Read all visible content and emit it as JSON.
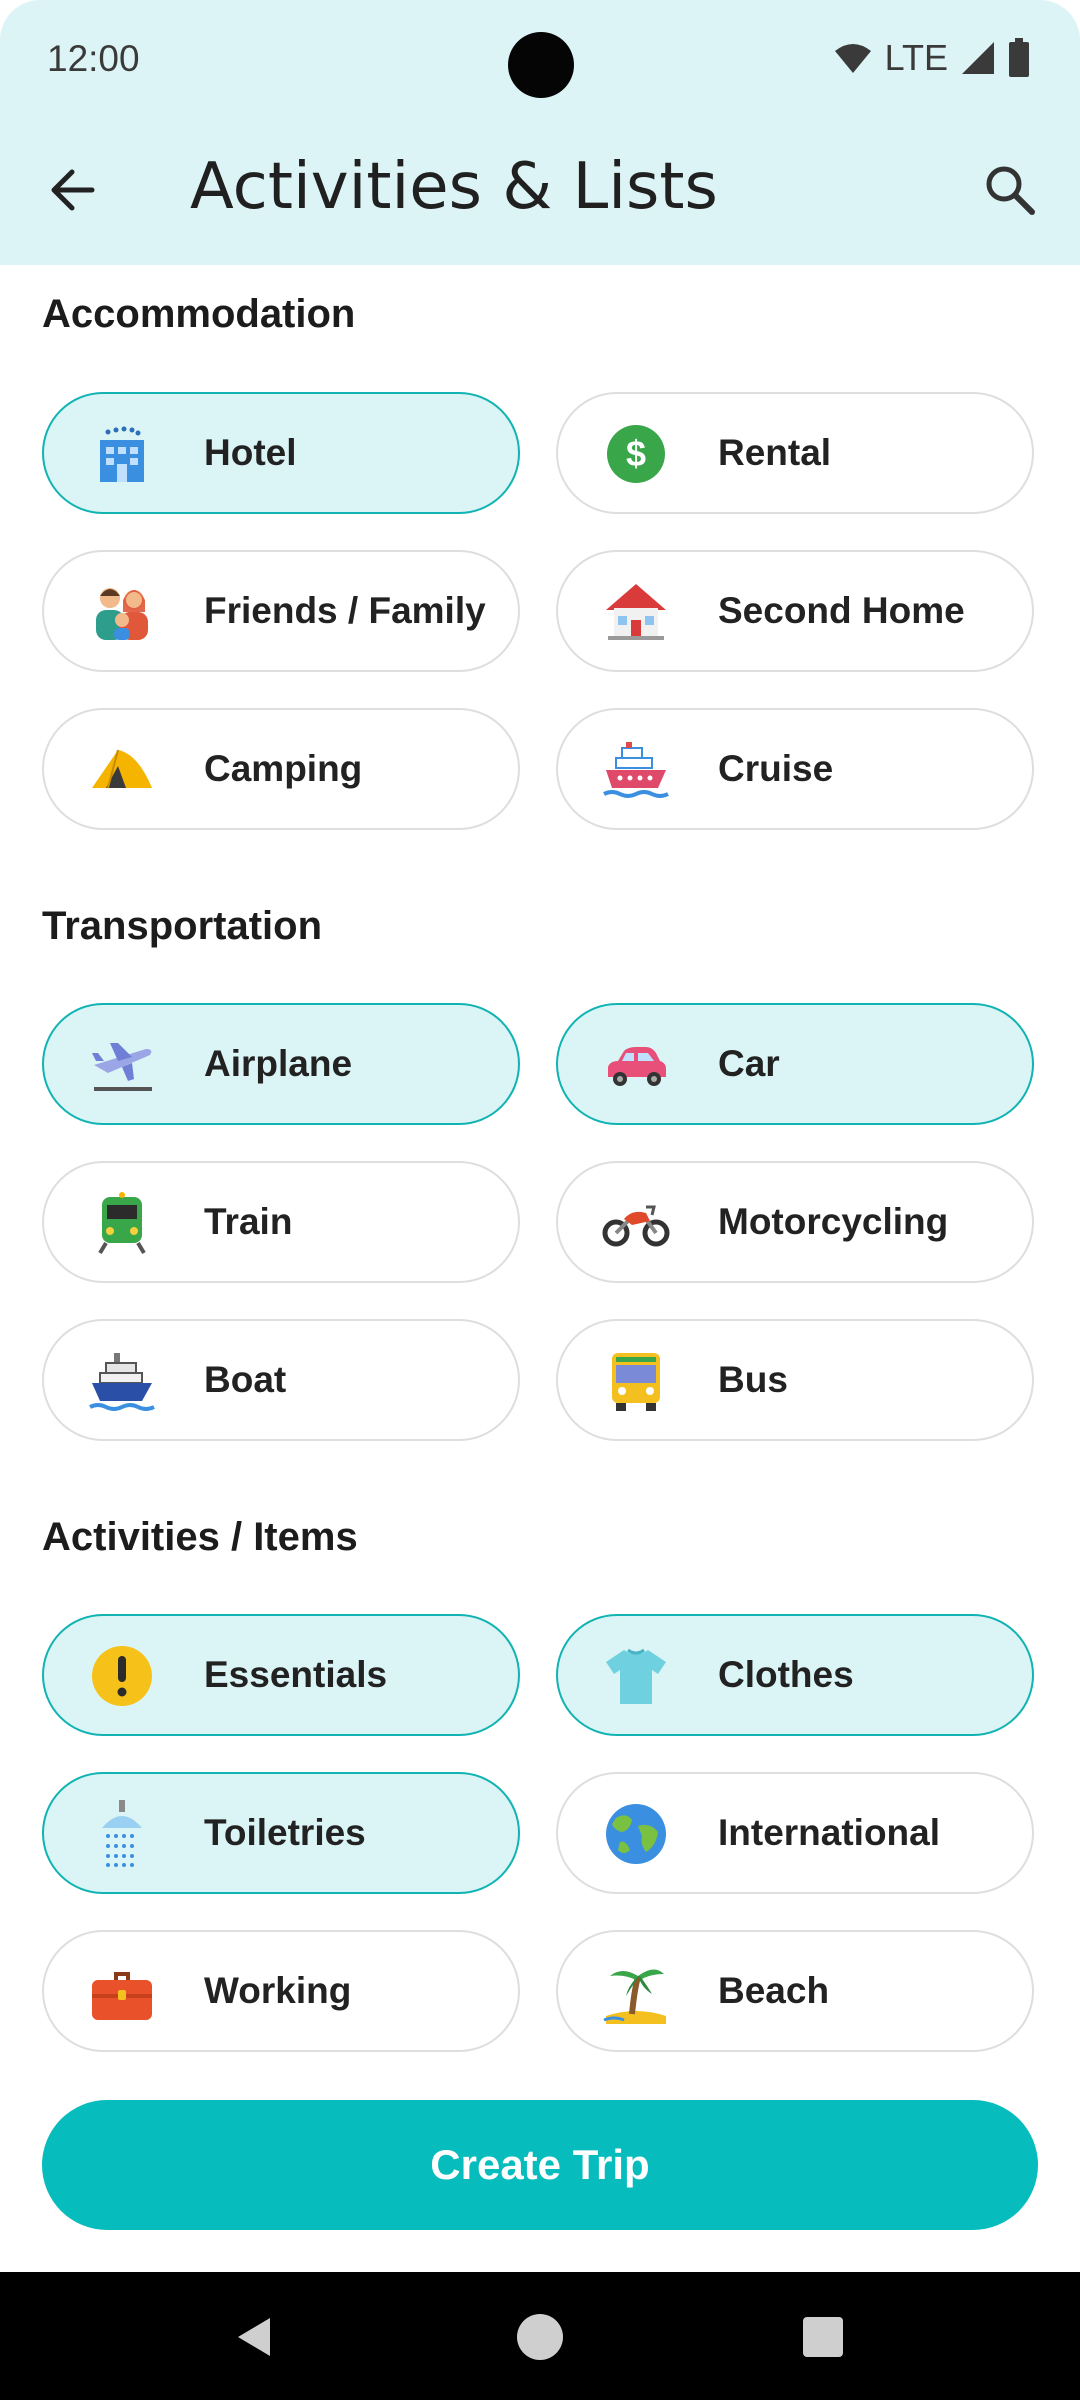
{
  "status": {
    "time": "12:00",
    "network": "LTE"
  },
  "header": {
    "title": "Activities & Lists"
  },
  "sections": [
    {
      "title": "Accommodation",
      "items": [
        {
          "label": "Hotel",
          "icon": "hotel-icon",
          "selected": true
        },
        {
          "label": "Rental",
          "icon": "dollar-icon",
          "selected": false
        },
        {
          "label": "Friends / Family",
          "icon": "family-icon",
          "selected": false
        },
        {
          "label": "Second Home",
          "icon": "house-icon",
          "selected": false
        },
        {
          "label": "Camping",
          "icon": "tent-icon",
          "selected": false
        },
        {
          "label": "Cruise",
          "icon": "cruise-ship-icon",
          "selected": false
        }
      ]
    },
    {
      "title": "Transportation",
      "items": [
        {
          "label": "Airplane",
          "icon": "airplane-icon",
          "selected": true
        },
        {
          "label": "Car",
          "icon": "car-icon",
          "selected": true
        },
        {
          "label": "Train",
          "icon": "train-icon",
          "selected": false
        },
        {
          "label": "Motorcycling",
          "icon": "motorcycle-icon",
          "selected": false
        },
        {
          "label": "Boat",
          "icon": "boat-icon",
          "selected": false
        },
        {
          "label": "Bus",
          "icon": "bus-icon",
          "selected": false
        }
      ]
    },
    {
      "title": "Activities / Items",
      "items": [
        {
          "label": "Essentials",
          "icon": "exclamation-icon",
          "selected": true
        },
        {
          "label": "Clothes",
          "icon": "tshirt-icon",
          "selected": true
        },
        {
          "label": "Toiletries",
          "icon": "shower-icon",
          "selected": true
        },
        {
          "label": "International",
          "icon": "globe-icon",
          "selected": false
        },
        {
          "label": "Working",
          "icon": "briefcase-icon",
          "selected": false
        },
        {
          "label": "Beach",
          "icon": "palm-tree-icon",
          "selected": false
        }
      ]
    }
  ],
  "actions": {
    "create_label": "Create Trip"
  },
  "colors": {
    "accent": "#06bcbc",
    "selected_bg": "#dbf4f5",
    "header_bg": "#dcf4f5"
  }
}
